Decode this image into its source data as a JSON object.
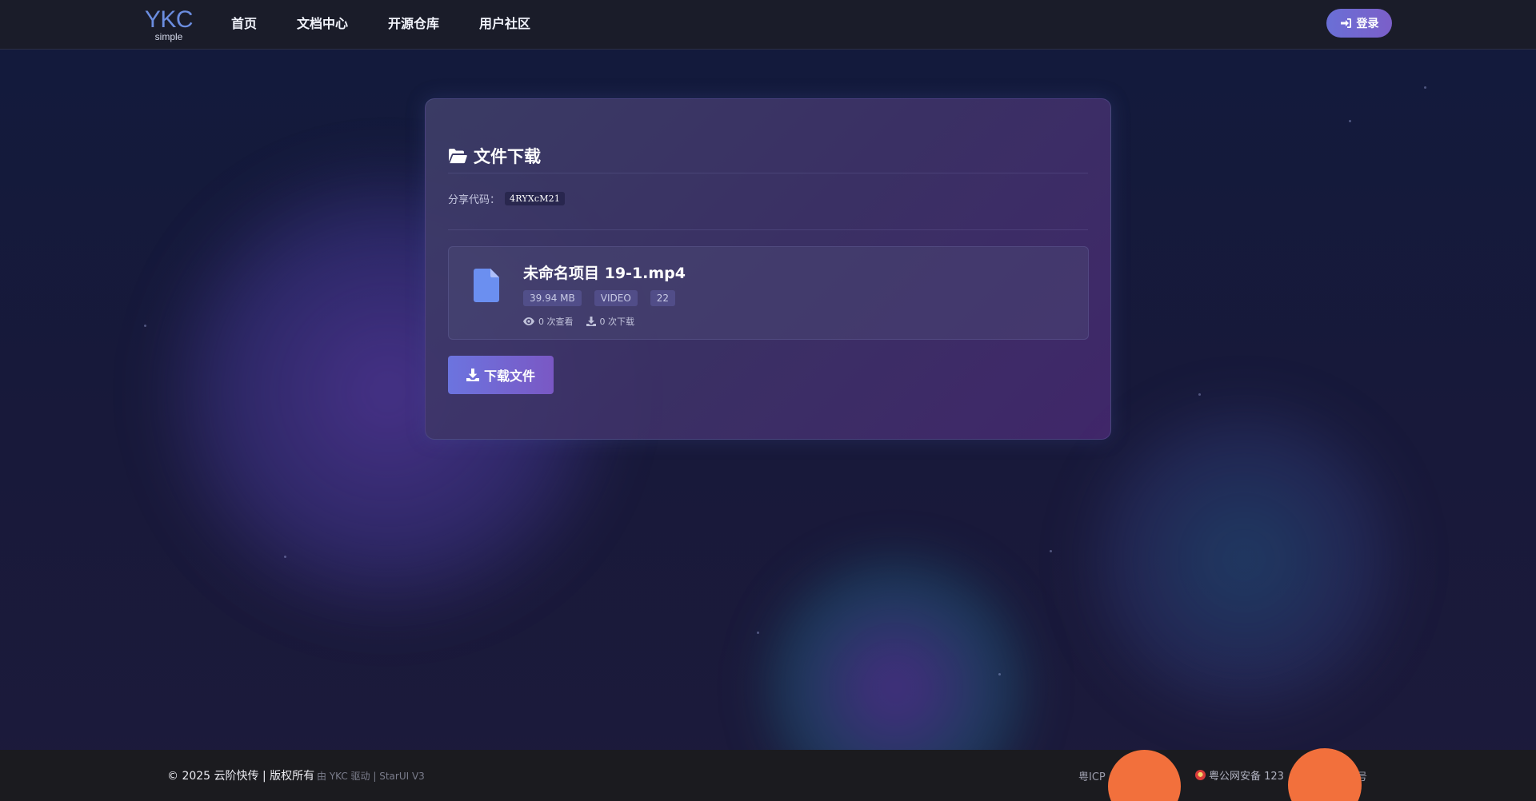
{
  "nav": {
    "logo_main": "YKC",
    "logo_sub": "simple",
    "links": [
      {
        "label": "首页"
      },
      {
        "label": "文档中心"
      },
      {
        "label": "开源仓库"
      },
      {
        "label": "用户社区"
      }
    ],
    "login_label": "登录",
    "login_icon": "sign-in-icon"
  },
  "card": {
    "title": "文件下载",
    "title_icon": "folder-open-icon",
    "share_label": "分享代码：",
    "share_code": "4RYXcM21",
    "file": {
      "icon": "file-icon",
      "name": "未命名项目 19-1.mp4",
      "size": "39.94 MB",
      "type": "VIDEO",
      "extra_tag": "22",
      "views": "0 次查看",
      "downloads": "0 次下载"
    },
    "download_label": "下载文件"
  },
  "footer": {
    "copyright": "© 2025 云阶快传 | 版权所有",
    "powered": "由 YKC 驱动 | StarUI V3",
    "icp": "粤ICP",
    "police": "粤公网安备 123",
    "police_suffix": "号"
  },
  "colors": {
    "accent": "#6a6fd6",
    "accent_purple": "#7b5fc8",
    "file_icon": "#6b8ff0",
    "orange_marker": "#f2703c"
  }
}
